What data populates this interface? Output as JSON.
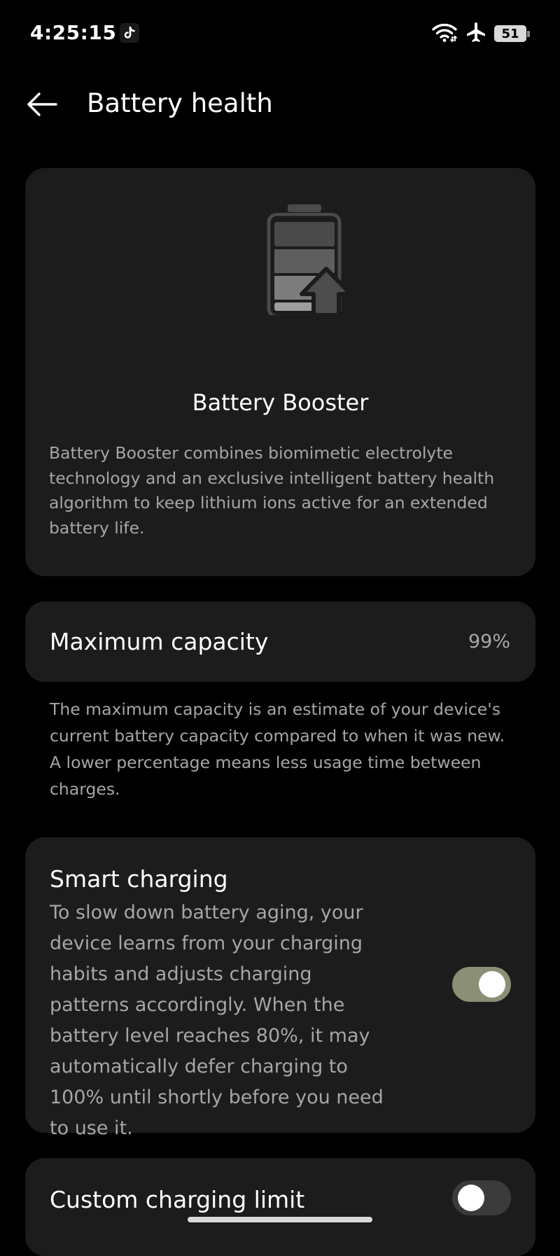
{
  "status_bar": {
    "time": "4:25:15",
    "notification_icon": "tiktok-icon",
    "wifi_icon": "wifi-icon",
    "airplane_icon": "airplane-icon",
    "battery_level": "51"
  },
  "header": {
    "back_icon": "back-arrow-icon",
    "title": "Battery health"
  },
  "booster": {
    "icon": "battery-booster-icon",
    "title": "Battery Booster",
    "description": "Battery Booster combines biomimetic electrolyte technology and an exclusive intelligent battery health algorithm to keep lithium ions active for an extended battery life."
  },
  "capacity": {
    "label": "Maximum capacity",
    "value": "99%",
    "note": "The maximum capacity is an estimate of your device's current battery capacity compared to when it was new. A lower percentage means less usage time between charges."
  },
  "smart_charging": {
    "title": "Smart charging",
    "description": "To slow down battery aging, your device learns from your charging habits and adjusts charging patterns accordingly. When the battery level reaches 80%, it may automatically defer charging to 100% until shortly before you need to use it.",
    "enabled": true
  },
  "custom_limit": {
    "title": "Custom charging limit",
    "enabled": false
  },
  "colors": {
    "background": "#000000",
    "card": "#1c1c1c",
    "secondary_text": "#a6a6a6",
    "toggle_on": "#8a8f76",
    "toggle_off": "#3b3b3b"
  }
}
